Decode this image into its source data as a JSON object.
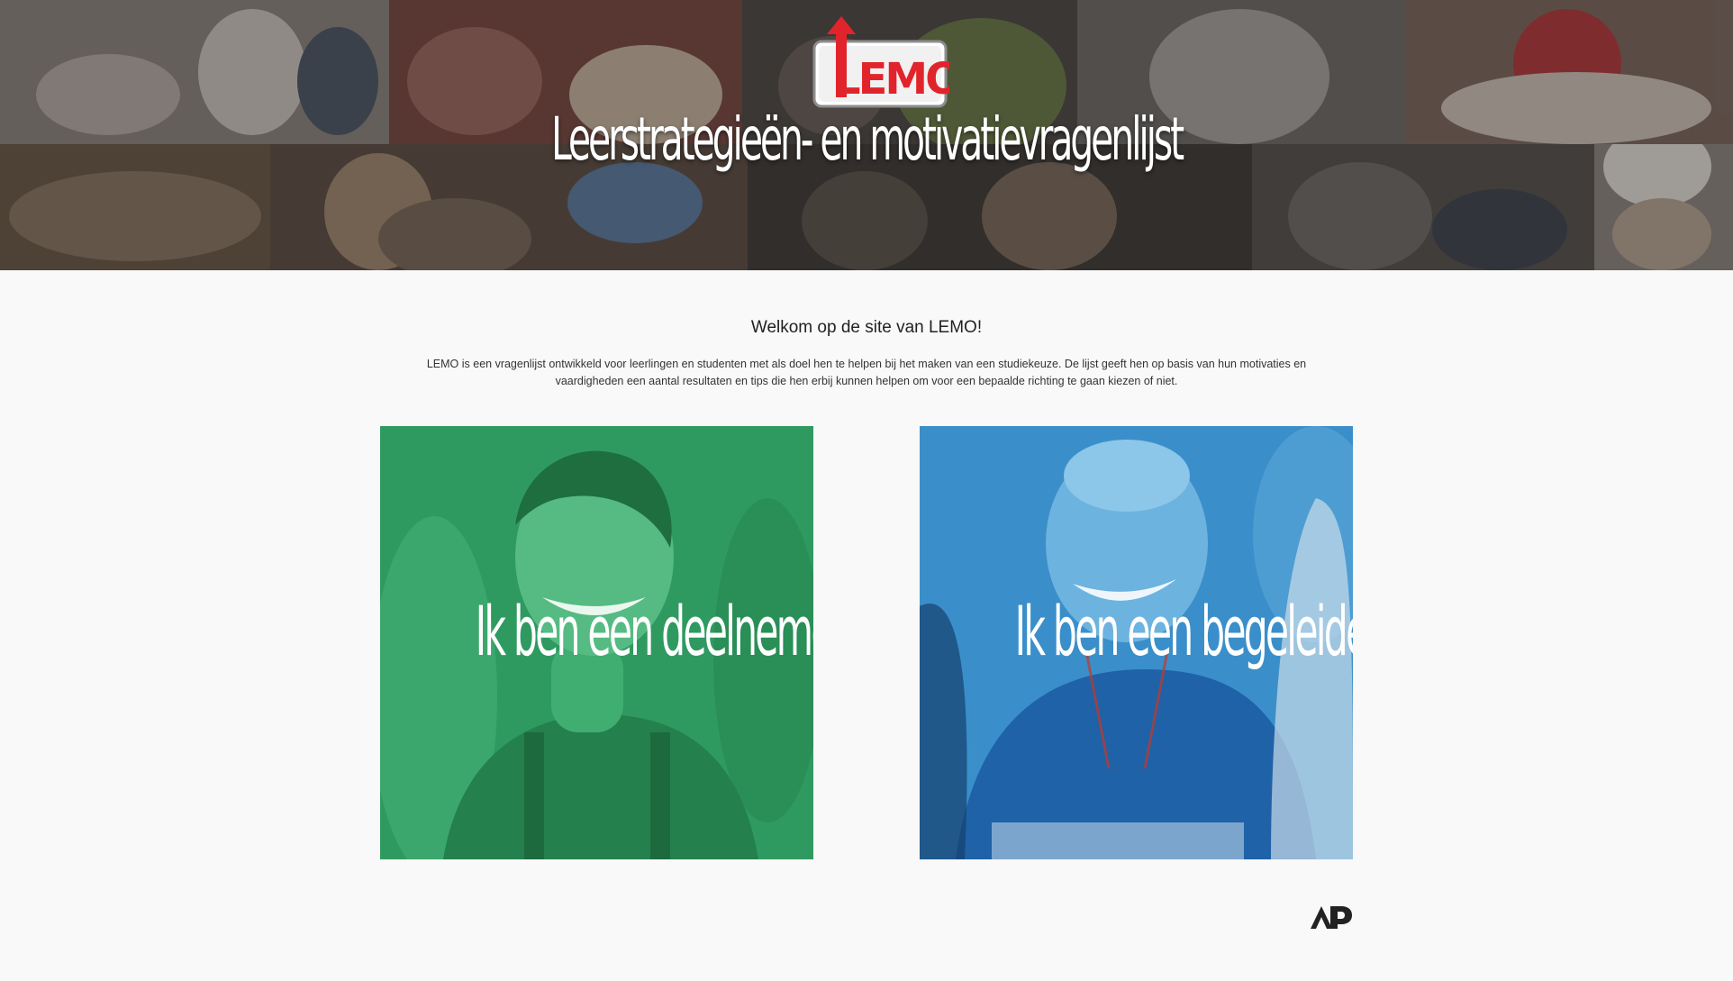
{
  "hero": {
    "logo_text": "LEMO",
    "title": "Leerstrategieën- en motivatievragenlijst"
  },
  "intro": {
    "heading": "Welkom op de site van LEMO!",
    "body": "LEMO is een vragenlijst ontwikkeld voor leerlingen en studenten met als doel hen te helpen bij het maken van een studiekeuze. De lijst geeft hen op basis van hun motivaties en vaardigheden een aantal resultaten en tips die hen erbij kunnen helpen om voor een bepaalde richting te gaan kiezen of niet."
  },
  "cards": {
    "participant": {
      "label": "Ik ben een deelnemer",
      "overlay_color": "#2fa265"
    },
    "supervisor": {
      "label": "Ik ben een begeleider",
      "overlay_color": "#2f86c4"
    }
  },
  "footer": {
    "brand_icon": "ap-logo-icon"
  },
  "colors": {
    "page_background": "#f9f9f9",
    "logo_red": "#e1242b",
    "title_white": "#ffffff"
  }
}
